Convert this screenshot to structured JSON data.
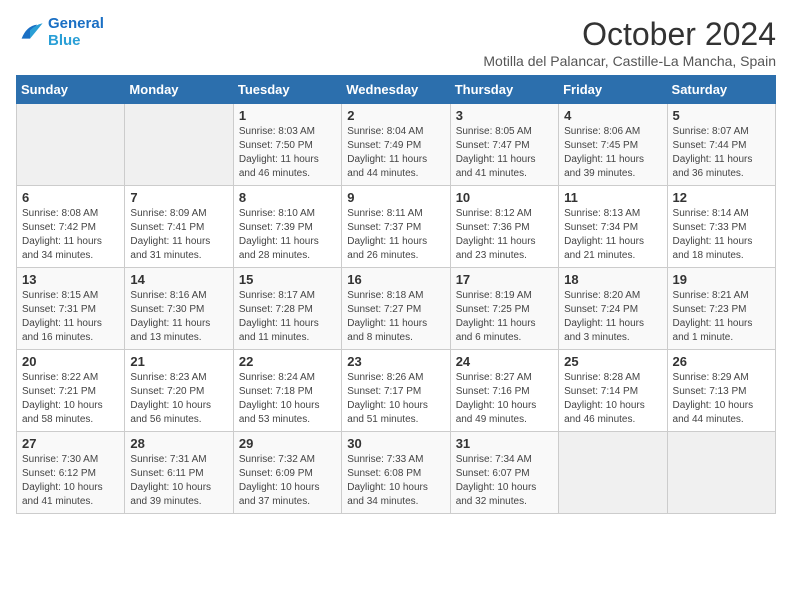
{
  "logo": {
    "line1": "General",
    "line2": "Blue"
  },
  "title": "October 2024",
  "subtitle": "Motilla del Palancar, Castille-La Mancha, Spain",
  "weekdays": [
    "Sunday",
    "Monday",
    "Tuesday",
    "Wednesday",
    "Thursday",
    "Friday",
    "Saturday"
  ],
  "weeks": [
    [
      {
        "day": "",
        "sunrise": "",
        "sunset": "",
        "daylight": ""
      },
      {
        "day": "",
        "sunrise": "",
        "sunset": "",
        "daylight": ""
      },
      {
        "day": "1",
        "sunrise": "Sunrise: 8:03 AM",
        "sunset": "Sunset: 7:50 PM",
        "daylight": "Daylight: 11 hours and 46 minutes."
      },
      {
        "day": "2",
        "sunrise": "Sunrise: 8:04 AM",
        "sunset": "Sunset: 7:49 PM",
        "daylight": "Daylight: 11 hours and 44 minutes."
      },
      {
        "day": "3",
        "sunrise": "Sunrise: 8:05 AM",
        "sunset": "Sunset: 7:47 PM",
        "daylight": "Daylight: 11 hours and 41 minutes."
      },
      {
        "day": "4",
        "sunrise": "Sunrise: 8:06 AM",
        "sunset": "Sunset: 7:45 PM",
        "daylight": "Daylight: 11 hours and 39 minutes."
      },
      {
        "day": "5",
        "sunrise": "Sunrise: 8:07 AM",
        "sunset": "Sunset: 7:44 PM",
        "daylight": "Daylight: 11 hours and 36 minutes."
      }
    ],
    [
      {
        "day": "6",
        "sunrise": "Sunrise: 8:08 AM",
        "sunset": "Sunset: 7:42 PM",
        "daylight": "Daylight: 11 hours and 34 minutes."
      },
      {
        "day": "7",
        "sunrise": "Sunrise: 8:09 AM",
        "sunset": "Sunset: 7:41 PM",
        "daylight": "Daylight: 11 hours and 31 minutes."
      },
      {
        "day": "8",
        "sunrise": "Sunrise: 8:10 AM",
        "sunset": "Sunset: 7:39 PM",
        "daylight": "Daylight: 11 hours and 28 minutes."
      },
      {
        "day": "9",
        "sunrise": "Sunrise: 8:11 AM",
        "sunset": "Sunset: 7:37 PM",
        "daylight": "Daylight: 11 hours and 26 minutes."
      },
      {
        "day": "10",
        "sunrise": "Sunrise: 8:12 AM",
        "sunset": "Sunset: 7:36 PM",
        "daylight": "Daylight: 11 hours and 23 minutes."
      },
      {
        "day": "11",
        "sunrise": "Sunrise: 8:13 AM",
        "sunset": "Sunset: 7:34 PM",
        "daylight": "Daylight: 11 hours and 21 minutes."
      },
      {
        "day": "12",
        "sunrise": "Sunrise: 8:14 AM",
        "sunset": "Sunset: 7:33 PM",
        "daylight": "Daylight: 11 hours and 18 minutes."
      }
    ],
    [
      {
        "day": "13",
        "sunrise": "Sunrise: 8:15 AM",
        "sunset": "Sunset: 7:31 PM",
        "daylight": "Daylight: 11 hours and 16 minutes."
      },
      {
        "day": "14",
        "sunrise": "Sunrise: 8:16 AM",
        "sunset": "Sunset: 7:30 PM",
        "daylight": "Daylight: 11 hours and 13 minutes."
      },
      {
        "day": "15",
        "sunrise": "Sunrise: 8:17 AM",
        "sunset": "Sunset: 7:28 PM",
        "daylight": "Daylight: 11 hours and 11 minutes."
      },
      {
        "day": "16",
        "sunrise": "Sunrise: 8:18 AM",
        "sunset": "Sunset: 7:27 PM",
        "daylight": "Daylight: 11 hours and 8 minutes."
      },
      {
        "day": "17",
        "sunrise": "Sunrise: 8:19 AM",
        "sunset": "Sunset: 7:25 PM",
        "daylight": "Daylight: 11 hours and 6 minutes."
      },
      {
        "day": "18",
        "sunrise": "Sunrise: 8:20 AM",
        "sunset": "Sunset: 7:24 PM",
        "daylight": "Daylight: 11 hours and 3 minutes."
      },
      {
        "day": "19",
        "sunrise": "Sunrise: 8:21 AM",
        "sunset": "Sunset: 7:23 PM",
        "daylight": "Daylight: 11 hours and 1 minute."
      }
    ],
    [
      {
        "day": "20",
        "sunrise": "Sunrise: 8:22 AM",
        "sunset": "Sunset: 7:21 PM",
        "daylight": "Daylight: 10 hours and 58 minutes."
      },
      {
        "day": "21",
        "sunrise": "Sunrise: 8:23 AM",
        "sunset": "Sunset: 7:20 PM",
        "daylight": "Daylight: 10 hours and 56 minutes."
      },
      {
        "day": "22",
        "sunrise": "Sunrise: 8:24 AM",
        "sunset": "Sunset: 7:18 PM",
        "daylight": "Daylight: 10 hours and 53 minutes."
      },
      {
        "day": "23",
        "sunrise": "Sunrise: 8:26 AM",
        "sunset": "Sunset: 7:17 PM",
        "daylight": "Daylight: 10 hours and 51 minutes."
      },
      {
        "day": "24",
        "sunrise": "Sunrise: 8:27 AM",
        "sunset": "Sunset: 7:16 PM",
        "daylight": "Daylight: 10 hours and 49 minutes."
      },
      {
        "day": "25",
        "sunrise": "Sunrise: 8:28 AM",
        "sunset": "Sunset: 7:14 PM",
        "daylight": "Daylight: 10 hours and 46 minutes."
      },
      {
        "day": "26",
        "sunrise": "Sunrise: 8:29 AM",
        "sunset": "Sunset: 7:13 PM",
        "daylight": "Daylight: 10 hours and 44 minutes."
      }
    ],
    [
      {
        "day": "27",
        "sunrise": "Sunrise: 7:30 AM",
        "sunset": "Sunset: 6:12 PM",
        "daylight": "Daylight: 10 hours and 41 minutes."
      },
      {
        "day": "28",
        "sunrise": "Sunrise: 7:31 AM",
        "sunset": "Sunset: 6:11 PM",
        "daylight": "Daylight: 10 hours and 39 minutes."
      },
      {
        "day": "29",
        "sunrise": "Sunrise: 7:32 AM",
        "sunset": "Sunset: 6:09 PM",
        "daylight": "Daylight: 10 hours and 37 minutes."
      },
      {
        "day": "30",
        "sunrise": "Sunrise: 7:33 AM",
        "sunset": "Sunset: 6:08 PM",
        "daylight": "Daylight: 10 hours and 34 minutes."
      },
      {
        "day": "31",
        "sunrise": "Sunrise: 7:34 AM",
        "sunset": "Sunset: 6:07 PM",
        "daylight": "Daylight: 10 hours and 32 minutes."
      },
      {
        "day": "",
        "sunrise": "",
        "sunset": "",
        "daylight": ""
      },
      {
        "day": "",
        "sunrise": "",
        "sunset": "",
        "daylight": ""
      }
    ]
  ]
}
